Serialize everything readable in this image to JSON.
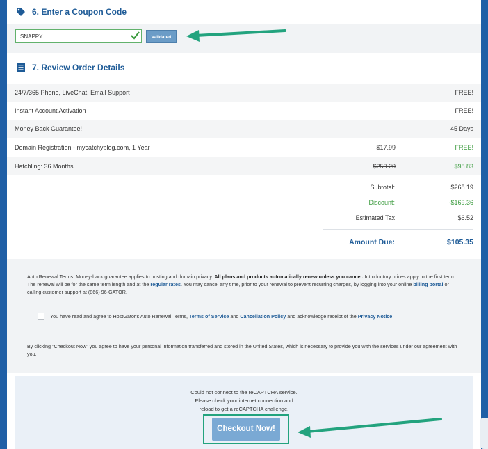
{
  "coupon_section": {
    "number_title": "6. Enter a Coupon Code",
    "icon": "tag-icon",
    "code_value": "SNAPPY",
    "validated_label": "Validated"
  },
  "review_section": {
    "number_title": "7. Review Order Details",
    "icon": "list-icon",
    "rows": [
      {
        "label": "24/7/365 Phone, LiveChat, Email Support",
        "old_price": "",
        "value": "FREE!"
      },
      {
        "label": "Instant Account Activation",
        "old_price": "",
        "value": "FREE!"
      },
      {
        "label": "Money Back Guarantee!",
        "old_price": "",
        "value": "45 Days"
      },
      {
        "label": "Domain Registration - mycatchyblog.com, 1 Year",
        "old_price": "$17.99",
        "value": "FREE!"
      },
      {
        "label": "Hatchling: 36 Months",
        "old_price": "$250.20",
        "value": "$98.83"
      }
    ],
    "subtotal_label": "Subtotal:",
    "subtotal_value": "$268.19",
    "discount_label": "Discount:",
    "discount_value": "-$169.36",
    "tax_label": "Estimated Tax",
    "tax_value": "$6.52",
    "amount_due_label": "Amount Due:",
    "amount_due_value": "$105.35"
  },
  "terms": {
    "auto_renewal_prefix": "Auto Renewal Terms: Money-back guarantee applies to hosting and domain privacy. ",
    "auto_renewal_bold": "All plans and products automatically renew unless you cancel.",
    "auto_renewal_mid": " Introductory prices apply to the first term. The renewal will be for the same term length and at the ",
    "regular_rates_link": "regular rates",
    "auto_renewal_mid2": ". You may cancel any time, prior to your renewal to prevent recurring charges, by logging into your online ",
    "billing_portal_link": "billing portal",
    "auto_renewal_suffix": " or calling customer support at (866) 96-GATOR.",
    "agree_prefix": "You have read and agree to HostGator's Auto Renewal Terms, ",
    "tos_link": "Terms of Service",
    "agree_and": " and ",
    "cancellation_link": "Cancellation Policy",
    "agree_mid": " and acknowledge receipt of the ",
    "privacy_link": "Privacy Notice",
    "agree_suffix": ".",
    "checkout_consent": "By clicking \"Checkout Now\" you agree to have your personal information transferred and stored in the United States, which is necessary to provide you with the services under our agreement with you."
  },
  "recaptcha": {
    "line1": "Could not connect to the reCAPTCHA service.",
    "line2": "Please check your internet connection and",
    "line3": "reload to get a reCAPTCHA challenge."
  },
  "checkout": {
    "button_label": "Checkout Now!"
  },
  "colors": {
    "brand_blue": "#1e5b97",
    "page_blue": "#1f5fa6",
    "discount_green": "#3b9b3e",
    "annotation_teal": "#23a37e",
    "button_blue": "#7aa9d4"
  }
}
